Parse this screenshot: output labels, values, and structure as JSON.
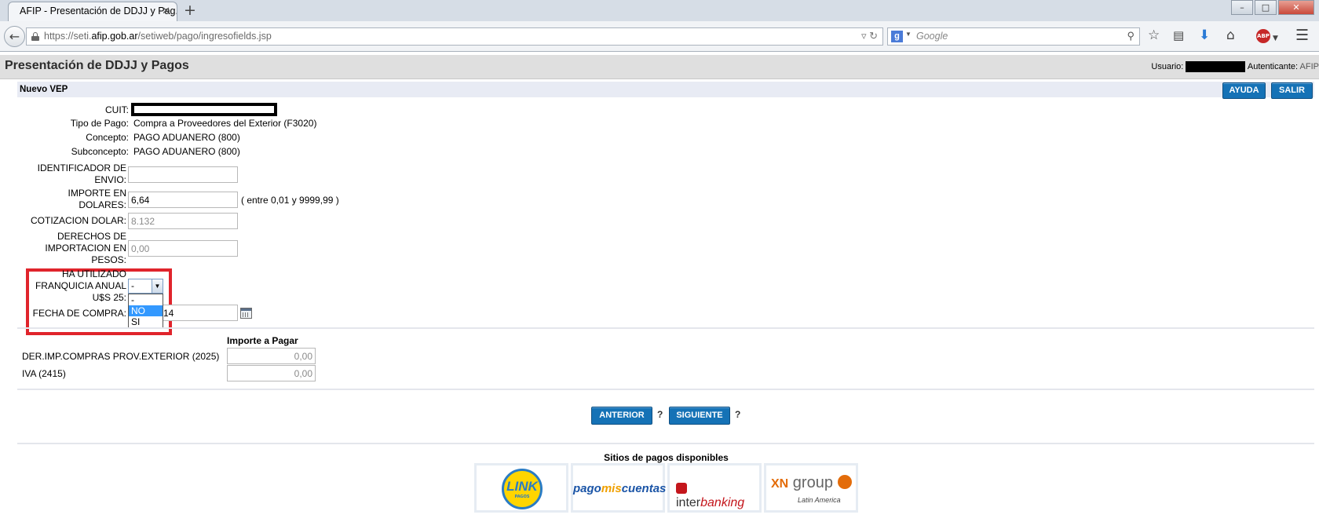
{
  "browser": {
    "tab_title": "AFIP - Presentación de DDJJ y Pag...",
    "tab_close": "✕",
    "new_tab": "+",
    "url_prefix": "https://seti.",
    "url_host": "afip.gob.ar",
    "url_path": "/setiweb/pago/ingresofields.jsp",
    "search_placeholder": "Google",
    "window_buttons": {
      "minimize": "–",
      "maximize": "□",
      "close": "✕"
    }
  },
  "page": {
    "title": "Presentación de DDJJ y Pagos",
    "user_label": "Usuario:",
    "authenticator_label": "Autenticante:",
    "authenticator_value": "AFIP",
    "section_title": "Nuevo VEP",
    "help_button": "AYUDA",
    "exit_button": "SALIR"
  },
  "form": {
    "cuit_label": "CUIT:",
    "tipo_pago_label": "Tipo de Pago:",
    "tipo_pago_value": "Compra a Proveedores del Exterior (F3020)",
    "concepto_label": "Concepto:",
    "concepto_value": "PAGO ADUANERO (800)",
    "subconcepto_label": "Subconcepto:",
    "subconcepto_value": "PAGO ADUANERO (800)",
    "identificador_label_1": "IDENTIFICADOR DE",
    "identificador_label_2": "ENVIO:",
    "identificador_value": "",
    "importe_label_1": "IMPORTE EN",
    "importe_label_2": "DOLARES:",
    "importe_value": "6,64",
    "importe_hint": "( entre 0,01 y 9999,99 )",
    "cotizacion_label": "COTIZACION DOLAR:",
    "cotizacion_value": "8.132",
    "derechos_label_1": "DERECHOS DE",
    "derechos_label_2": "IMPORTACION EN",
    "derechos_label_3": "PESOS:",
    "derechos_value": "0,00",
    "franquicia_label_1": "HA UTILIZADO",
    "franquicia_label_2": "FRANQUICIA ANUAL",
    "franquicia_label_3": "U$S 25:",
    "franquicia_selected": "-",
    "franquicia_options": [
      "-",
      "NO",
      "SI"
    ],
    "fecha_label": "FECHA DE COMPRA:",
    "fecha_value_visible": "14"
  },
  "table": {
    "header": "Importe a Pagar",
    "rows": [
      {
        "label": "DER.IMP.COMPRAS PROV.EXTERIOR (2025)",
        "value": "0,00"
      },
      {
        "label": "IVA (2415)",
        "value": "0,00"
      }
    ]
  },
  "nav": {
    "prev_button": "ANTERIOR",
    "next_button": "SIGUIENTE",
    "help_mark": "?"
  },
  "footer": {
    "title": "Sitios de pagos disponibles",
    "link_text": "LINK",
    "link_sub": "PAGOS",
    "pmc_a": "pago",
    "pmc_b": "mis",
    "pmc_c": "cuentas",
    "ib_a": "inter",
    "ib_b": "banking",
    "xn_a": "XN",
    "xn_b": "group",
    "xn_sub": "Latin America"
  }
}
